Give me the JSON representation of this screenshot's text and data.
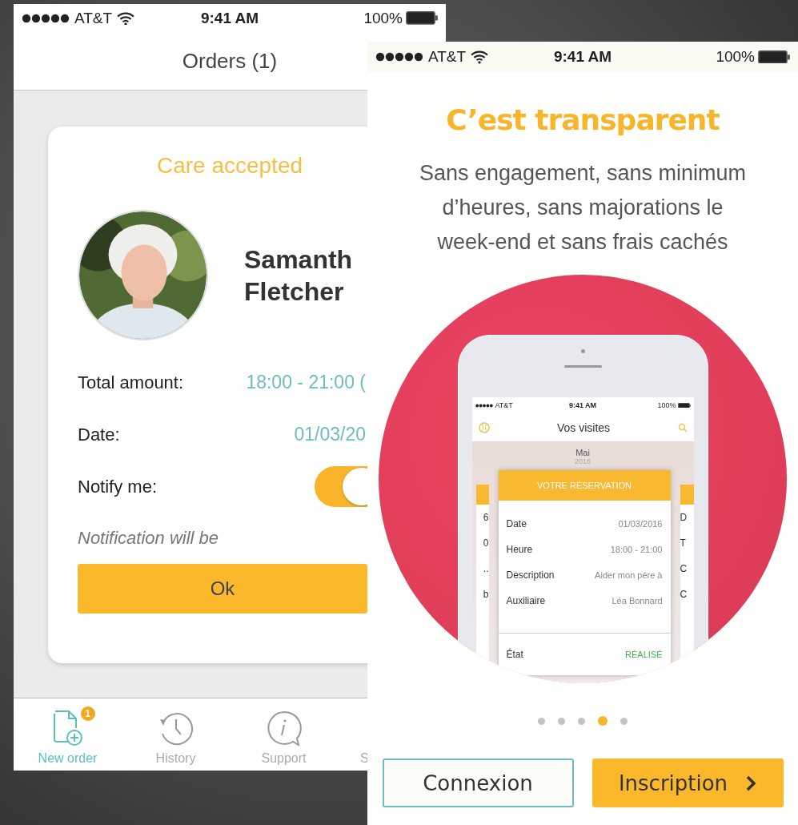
{
  "orders_screen": {
    "status_bar": {
      "carrier": "AT&T",
      "time": "9:41 AM",
      "battery": "100%"
    },
    "title": "Orders (1)",
    "card": {
      "title": "Care accepted",
      "name_lines": [
        "Samanth",
        "Fletcher"
      ],
      "fields": [
        {
          "label": "Total amount:",
          "value": "18:00 - 21:00 ("
        },
        {
          "label": "Date:",
          "value": "01/03/20"
        }
      ],
      "notify": {
        "label": "Notify me:",
        "on": true
      },
      "note": "Notification will be",
      "button": "Ok"
    },
    "tabs": [
      {
        "label": "New order",
        "selected": true,
        "badge": "1"
      },
      {
        "label": "History",
        "selected": false
      },
      {
        "label": "Support",
        "selected": false
      },
      {
        "label": "S",
        "selected": false
      }
    ]
  },
  "onboarding_screen": {
    "status_bar": {
      "carrier": "AT&T",
      "time": "9:41 AM",
      "battery": "100%"
    },
    "headline": "C’est transparent",
    "text": "Sans engagement, sans minimum d’heures, sans majorations le week-end et sans frais cachés",
    "preview": {
      "status_bar": {
        "carrier": "AT&T",
        "time": "9:41 AM",
        "battery": "100%"
      },
      "title": "Vos visites",
      "month": "Mai",
      "year": "2016",
      "card_title": "VOTRE RÉSERVATION",
      "rows": [
        {
          "label": "Date",
          "value": "01/03/2016"
        },
        {
          "label": "Heure",
          "value": "18:00 - 21:00"
        },
        {
          "label": "Description",
          "value": "Aider mon pére à"
        },
        {
          "label": "Auxiliaire",
          "value": "Léa Bonnard"
        }
      ],
      "status": {
        "label": "État",
        "value": "RÉALISÉ"
      },
      "left_card_fragments": [
        "6",
        "0",
        "..",
        "b"
      ],
      "right_card_fragments": [
        "D",
        "T",
        "C",
        "C"
      ]
    },
    "pager": [
      {
        "selected": false
      },
      {
        "selected": false
      },
      {
        "selected": false
      },
      {
        "selected": true
      },
      {
        "selected": false
      }
    ],
    "buttons": [
      {
        "label": "Connexion",
        "kind": "outline"
      },
      {
        "label": "Inscription",
        "kind": "primary"
      }
    ]
  }
}
